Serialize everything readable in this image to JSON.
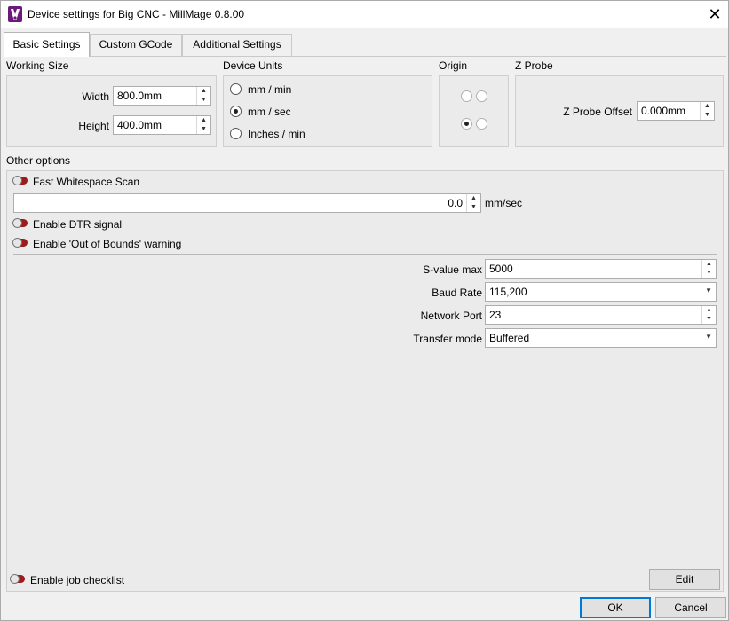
{
  "window": {
    "title": "Device settings for Big CNC - MillMage 0.8.00"
  },
  "tabs": [
    {
      "label": "Basic Settings"
    },
    {
      "label": "Custom GCode"
    },
    {
      "label": "Additional Settings"
    }
  ],
  "working_size": {
    "title": "Working Size",
    "width_label": "Width",
    "width_value": "800.0mm",
    "height_label": "Height",
    "height_value": "400.0mm"
  },
  "device_units": {
    "title": "Device Units",
    "options": [
      "mm / min",
      "mm / sec",
      "Inches / min"
    ],
    "selected": "mm / sec"
  },
  "origin": {
    "title": "Origin",
    "selected": "bottom-left"
  },
  "z_probe": {
    "title": "Z Probe",
    "offset_label": "Z Probe Offset",
    "offset_value": "0.000mm"
  },
  "other_options": {
    "title": "Other options",
    "fast_whitespace_label": "Fast Whitespace Scan",
    "fast_whitespace_enabled": false,
    "speed_value": "0.0",
    "speed_unit": "mm/sec",
    "dtr_label": "Enable DTR signal",
    "dtr_enabled": false,
    "oob_label": "Enable 'Out of Bounds' warning",
    "oob_enabled": false,
    "s_value_max_label": "S-value max",
    "s_value_max": "5000",
    "baud_rate_label": "Baud Rate",
    "baud_rate": "115,200",
    "network_port_label": "Network Port",
    "network_port": "23",
    "transfer_mode_label": "Transfer mode",
    "transfer_mode": "Buffered"
  },
  "job_checklist": {
    "label": "Enable job checklist",
    "enabled": false,
    "edit_label": "Edit"
  },
  "footer": {
    "ok_label": "OK",
    "cancel_label": "Cancel"
  },
  "colors": {
    "toggle_off": "#9b1c1c",
    "default_button_border": "#0078d7",
    "app_icon": "#6a1b7a"
  },
  "icons": [
    "millmage-app-icon",
    "close-icon",
    "spin-up-icon",
    "spin-down-icon",
    "dropdown-arrow-icon",
    "toggle-switch-icon"
  ]
}
